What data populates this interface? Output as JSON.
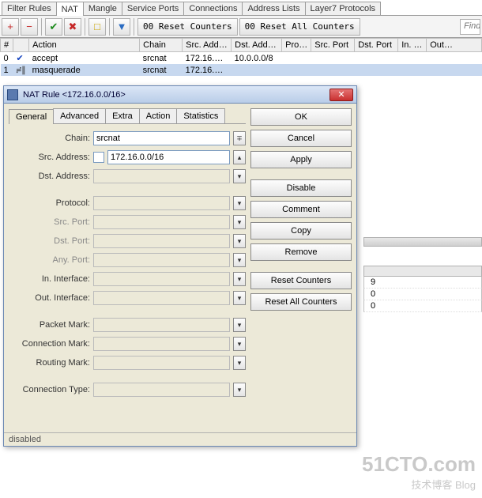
{
  "main_tabs": {
    "items": [
      "Filter Rules",
      "NAT",
      "Mangle",
      "Service Ports",
      "Connections",
      "Address Lists",
      "Layer7 Protocols"
    ],
    "active_index": 1
  },
  "toolbar": {
    "add": "+",
    "remove": "−",
    "enable": "✔",
    "disable": "✖",
    "comment": "□",
    "filter": "▼",
    "reset_counters": "00 Reset Counters",
    "reset_all_counters": "00 Reset All Counters",
    "find_placeholder": "Find"
  },
  "table": {
    "headers": [
      "#",
      "",
      "Action",
      "Chain",
      "Src. Add…",
      "Dst. Add…",
      "Pro…",
      "Src. Port",
      "Dst. Port",
      "In. …",
      "Out…"
    ],
    "rows": [
      {
        "num": "0",
        "icon": "✔",
        "icon_class": "ico-accept",
        "action": "accept",
        "chain": "srcnat",
        "src": "172.16.…",
        "dst": "10.0.0.0/8",
        "proto": "",
        "sport": "",
        "dport": "",
        "inif": "",
        "outif": ""
      },
      {
        "num": "1",
        "icon": "≓∥",
        "icon_class": "ico-masq",
        "action": "masquerade",
        "chain": "srcnat",
        "src": "172.16.…",
        "dst": "",
        "proto": "",
        "sport": "",
        "dport": "",
        "inif": "",
        "outif": ""
      }
    ]
  },
  "dialog": {
    "title": "NAT Rule <172.16.0.0/16>",
    "tabs": [
      "General",
      "Advanced",
      "Extra",
      "Action",
      "Statistics"
    ],
    "active_tab_index": 0,
    "fields": {
      "chain": {
        "label": "Chain:",
        "value": "srcnat"
      },
      "src_addr": {
        "label": "Src. Address:",
        "value": "172.16.0.0/16"
      },
      "dst_addr": {
        "label": "Dst. Address:",
        "value": ""
      },
      "protocol": {
        "label": "Protocol:",
        "value": ""
      },
      "src_port": {
        "label": "Src. Port:",
        "value": ""
      },
      "dst_port": {
        "label": "Dst. Port:",
        "value": ""
      },
      "any_port": {
        "label": "Any. Port:",
        "value": ""
      },
      "in_if": {
        "label": "In. Interface:",
        "value": ""
      },
      "out_if": {
        "label": "Out. Interface:",
        "value": ""
      },
      "packet_mark": {
        "label": "Packet Mark:",
        "value": ""
      },
      "conn_mark": {
        "label": "Connection Mark:",
        "value": ""
      },
      "routing_mark": {
        "label": "Routing Mark:",
        "value": ""
      },
      "conn_type": {
        "label": "Connection Type:",
        "value": ""
      }
    },
    "buttons": {
      "ok": "OK",
      "cancel": "Cancel",
      "apply": "Apply",
      "disable": "Disable",
      "comment": "Comment",
      "copy": "Copy",
      "remove": "Remove",
      "reset_counters": "Reset Counters",
      "reset_all": "Reset All Counters"
    },
    "status": "disabled"
  },
  "right_panel": {
    "values": [
      "9",
      "0",
      "0"
    ]
  },
  "watermark": {
    "big": "51CTO.com",
    "sub": "技术博客  Blog"
  }
}
